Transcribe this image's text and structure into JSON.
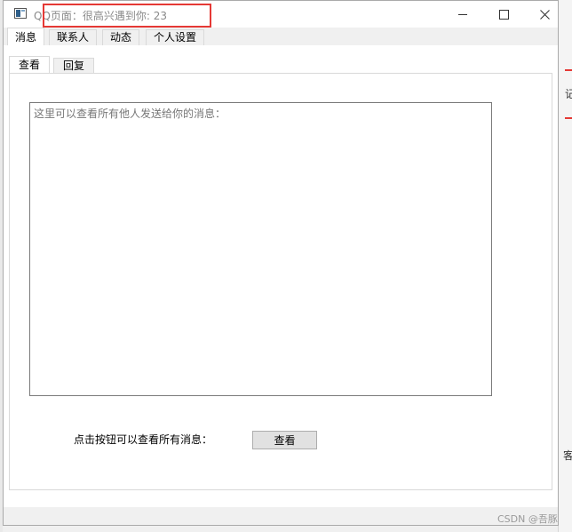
{
  "window": {
    "title": "QQ页面：很高兴遇到你: 23"
  },
  "outer_tabs": [
    {
      "label": "消息",
      "active": true
    },
    {
      "label": "联系人",
      "active": false
    },
    {
      "label": "动态",
      "active": false
    },
    {
      "label": "个人设置",
      "active": false
    }
  ],
  "inner_tabs": [
    {
      "label": "查看",
      "active": true
    },
    {
      "label": "回复",
      "active": false
    }
  ],
  "message_view": {
    "placeholder": "这里可以查看所有他人发送给你的消息：",
    "value": ""
  },
  "controls": {
    "hint_label": "点击按钮可以查看所有消息：",
    "view_button_label": "查看"
  },
  "background": {
    "right_glyph_top": "记",
    "right_glyph_bottom": "客"
  },
  "watermark": "CSDN @吾豚",
  "colors": {
    "highlight": "#e53935",
    "title_text": "#8a8a8a",
    "tab_border": "#d9d9d9"
  }
}
